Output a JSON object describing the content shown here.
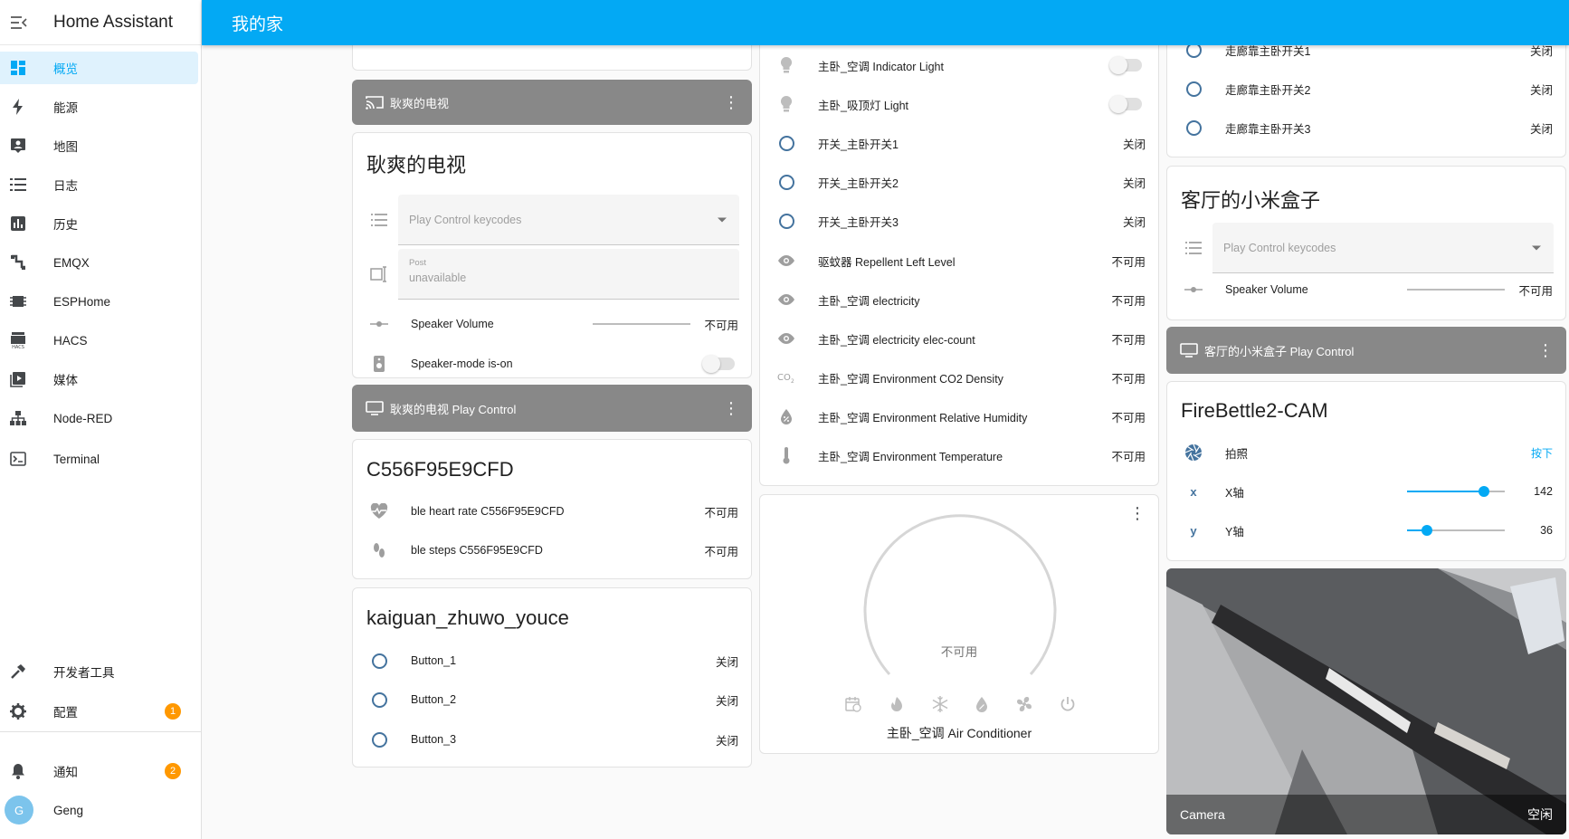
{
  "sidebar": {
    "app_title": "Home Assistant",
    "items": [
      {
        "label": "概览",
        "icon": "dashboard-icon"
      },
      {
        "label": "能源",
        "icon": "lightning-icon"
      },
      {
        "label": "地图",
        "icon": "map-account-icon"
      },
      {
        "label": "日志",
        "icon": "list-icon"
      },
      {
        "label": "历史",
        "icon": "chart-bar-icon"
      },
      {
        "label": "EMQX",
        "icon": "emqx-icon"
      },
      {
        "label": "ESPHome",
        "icon": "chip-icon"
      },
      {
        "label": "HACS",
        "icon": "hacs-icon"
      },
      {
        "label": "媒体",
        "icon": "play-box-icon"
      },
      {
        "label": "Node-RED",
        "icon": "sitemap-icon"
      },
      {
        "label": "Terminal",
        "icon": "console-icon"
      }
    ],
    "bottom": {
      "dev_tools": "开发者工具",
      "config": "配置",
      "config_badge": "1",
      "notifications": "通知",
      "notifications_badge": "2",
      "user": "Geng",
      "user_initial": "G"
    }
  },
  "header": {
    "title": "我的家"
  },
  "col1": {
    "tv_bar": "耿爽的电视",
    "tv_card": {
      "title": "耿爽的电视",
      "select_placeholder": "Play Control keycodes",
      "post_label": "Post",
      "post_value": "unavailable",
      "speaker_volume": "Speaker Volume",
      "speaker_volume_state": "不可用",
      "speaker_mode": "Speaker-mode is-on"
    },
    "tv_play_bar": "耿爽的电视 Play Control",
    "ble_card": {
      "title": "C556F95E9CFD",
      "rows": [
        {
          "name": "ble heart rate C556F95E9CFD",
          "state": "不可用"
        },
        {
          "name": "ble steps C556F95E9CFD",
          "state": "不可用"
        }
      ]
    },
    "kaiguan_card": {
      "title": "kaiguan_zhuwo_youce",
      "rows": [
        {
          "name": "Button_1",
          "state": "关闭"
        },
        {
          "name": "Button_2",
          "state": "关闭"
        },
        {
          "name": "Button_3",
          "state": "关闭"
        }
      ]
    }
  },
  "col2": {
    "entities": [
      {
        "name": "主卧_空调 Indicator Light",
        "icon": "lightbulb-icon"
      },
      {
        "name": "主卧_吸顶灯 Light",
        "icon": "lightbulb-icon"
      },
      {
        "name": "开关_主卧开关1",
        "state": "关闭"
      },
      {
        "name": "开关_主卧开关2",
        "state": "关闭"
      },
      {
        "name": "开关_主卧开关3",
        "state": "关闭"
      },
      {
        "name": "驱蚊器 Repellent Left Level",
        "state": "不可用",
        "icon": "eye-icon"
      },
      {
        "name": "主卧_空调 electricity",
        "state": "不可用",
        "icon": "eye-icon"
      },
      {
        "name": "主卧_空调 electricity elec-count",
        "state": "不可用",
        "icon": "eye-icon"
      },
      {
        "name": "主卧_空调 Environment CO2 Density",
        "state": "不可用",
        "icon": "co2-icon"
      },
      {
        "name": "主卧_空调 Environment Relative Humidity",
        "state": "不可用",
        "icon": "water-percent-icon"
      },
      {
        "name": "主卧_空调 Environment Temperature",
        "state": "不可用",
        "icon": "thermometer-icon"
      }
    ],
    "thermostat": {
      "state": "不可用",
      "name": "主卧_空调 Air Conditioner"
    }
  },
  "col3": {
    "top_rows": [
      {
        "name": "走廊靠主卧开关1",
        "state": "关闭"
      },
      {
        "name": "走廊靠主卧开关2",
        "state": "关闭"
      },
      {
        "name": "走廊靠主卧开关3",
        "state": "关闭"
      }
    ],
    "xiaomi_card": {
      "title": "客厅的小米盒子",
      "select_placeholder": "Play Control keycodes",
      "speaker_volume": "Speaker Volume",
      "speaker_volume_state": "不可用"
    },
    "xiaomi_play_bar": "客厅的小米盒子 Play Control",
    "cam_card": {
      "title": "FireBettle2-CAM",
      "photo_label": "拍照",
      "photo_action": "按下",
      "x_label": "X轴",
      "x_value": "142",
      "x_level": 0.79,
      "y_label": "Y轴",
      "y_value": "36",
      "y_level": 0.2
    },
    "camera": {
      "name": "Camera",
      "state": "空闲"
    }
  },
  "colors": {
    "accent": "#03a9f4",
    "entity_icon": "#44739e",
    "badge": "#ff9800",
    "media_bar": "#888888"
  }
}
